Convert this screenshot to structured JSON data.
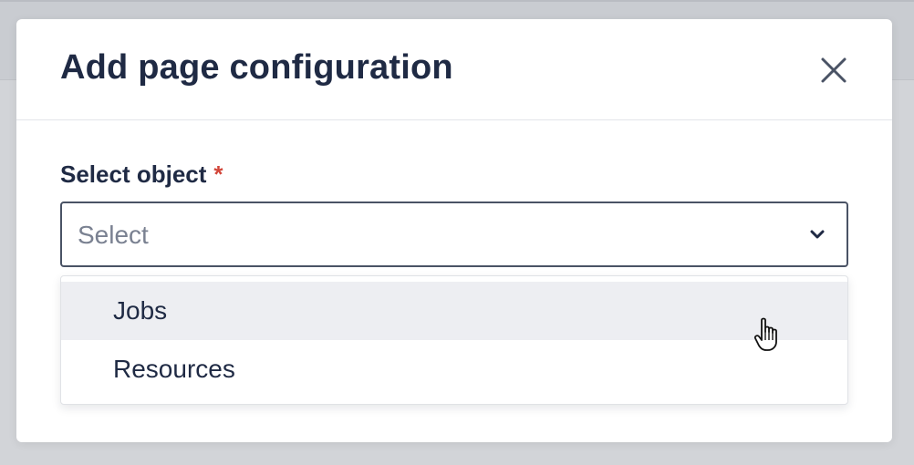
{
  "modal": {
    "title": "Add page configuration",
    "close_icon": "close-icon"
  },
  "field": {
    "label": "Select object",
    "required_marker": "*",
    "placeholder": "Select",
    "chevron_icon": "chevron-down-icon"
  },
  "dropdown": {
    "options": [
      {
        "label": "Jobs",
        "hovered": true
      },
      {
        "label": "Resources",
        "hovered": false
      }
    ]
  },
  "colors": {
    "title_text": "#1f2a44",
    "required": "#d2463a",
    "hover_bg": "#edeef2",
    "placeholder_text": "#7a8191"
  },
  "pointer": {
    "icon": "hand-pointer-icon"
  }
}
